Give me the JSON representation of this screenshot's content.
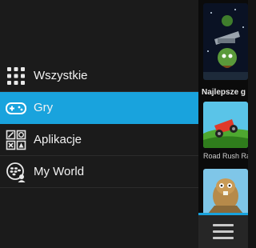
{
  "menu": {
    "items": [
      {
        "label": "Wszystkie",
        "icon": "all-grid-icon",
        "active": false
      },
      {
        "label": "Gry",
        "icon": "gamepad-icon",
        "active": true
      },
      {
        "label": "Aplikacje",
        "icon": "apps-icon",
        "active": false
      },
      {
        "label": "My World",
        "icon": "blackberry-world-icon",
        "active": false
      }
    ]
  },
  "content": {
    "section_title": "Najlepsze g",
    "items": [
      {
        "title": "Road Rush Ra"
      }
    ]
  },
  "colors": {
    "accent": "#19a3dd",
    "sidebar_bg": "#1b1b1b",
    "content_bg": "#0b0b0b"
  },
  "bottom_bar": {
    "menu_icon": "hamburger-menu-icon"
  }
}
